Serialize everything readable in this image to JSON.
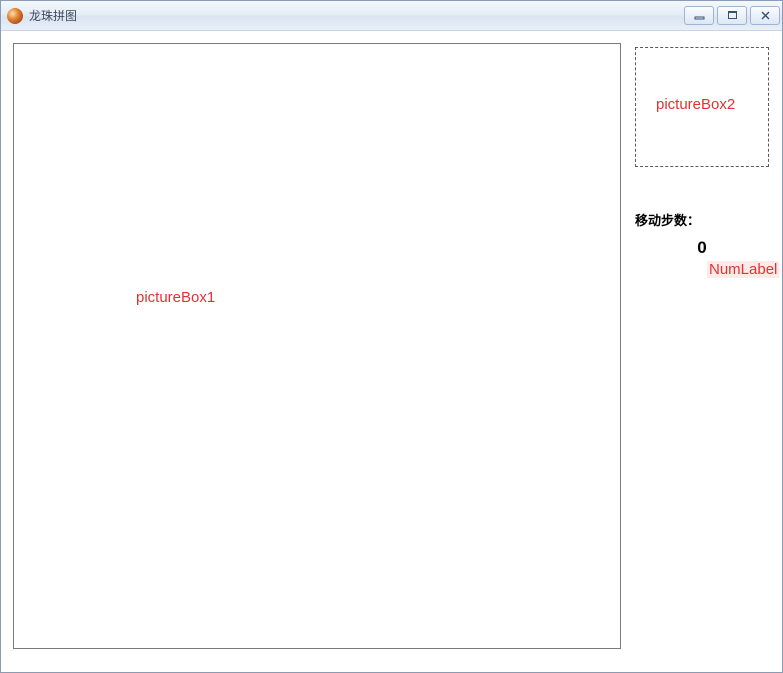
{
  "window": {
    "title": "龙珠拼图"
  },
  "designer": {
    "pb1_label": "pictureBox1",
    "pb2_label": "pictureBox2",
    "numlabel_mark": "NumLabel"
  },
  "labels": {
    "move_steps": "移动步数："
  },
  "values": {
    "move_count": "0"
  }
}
